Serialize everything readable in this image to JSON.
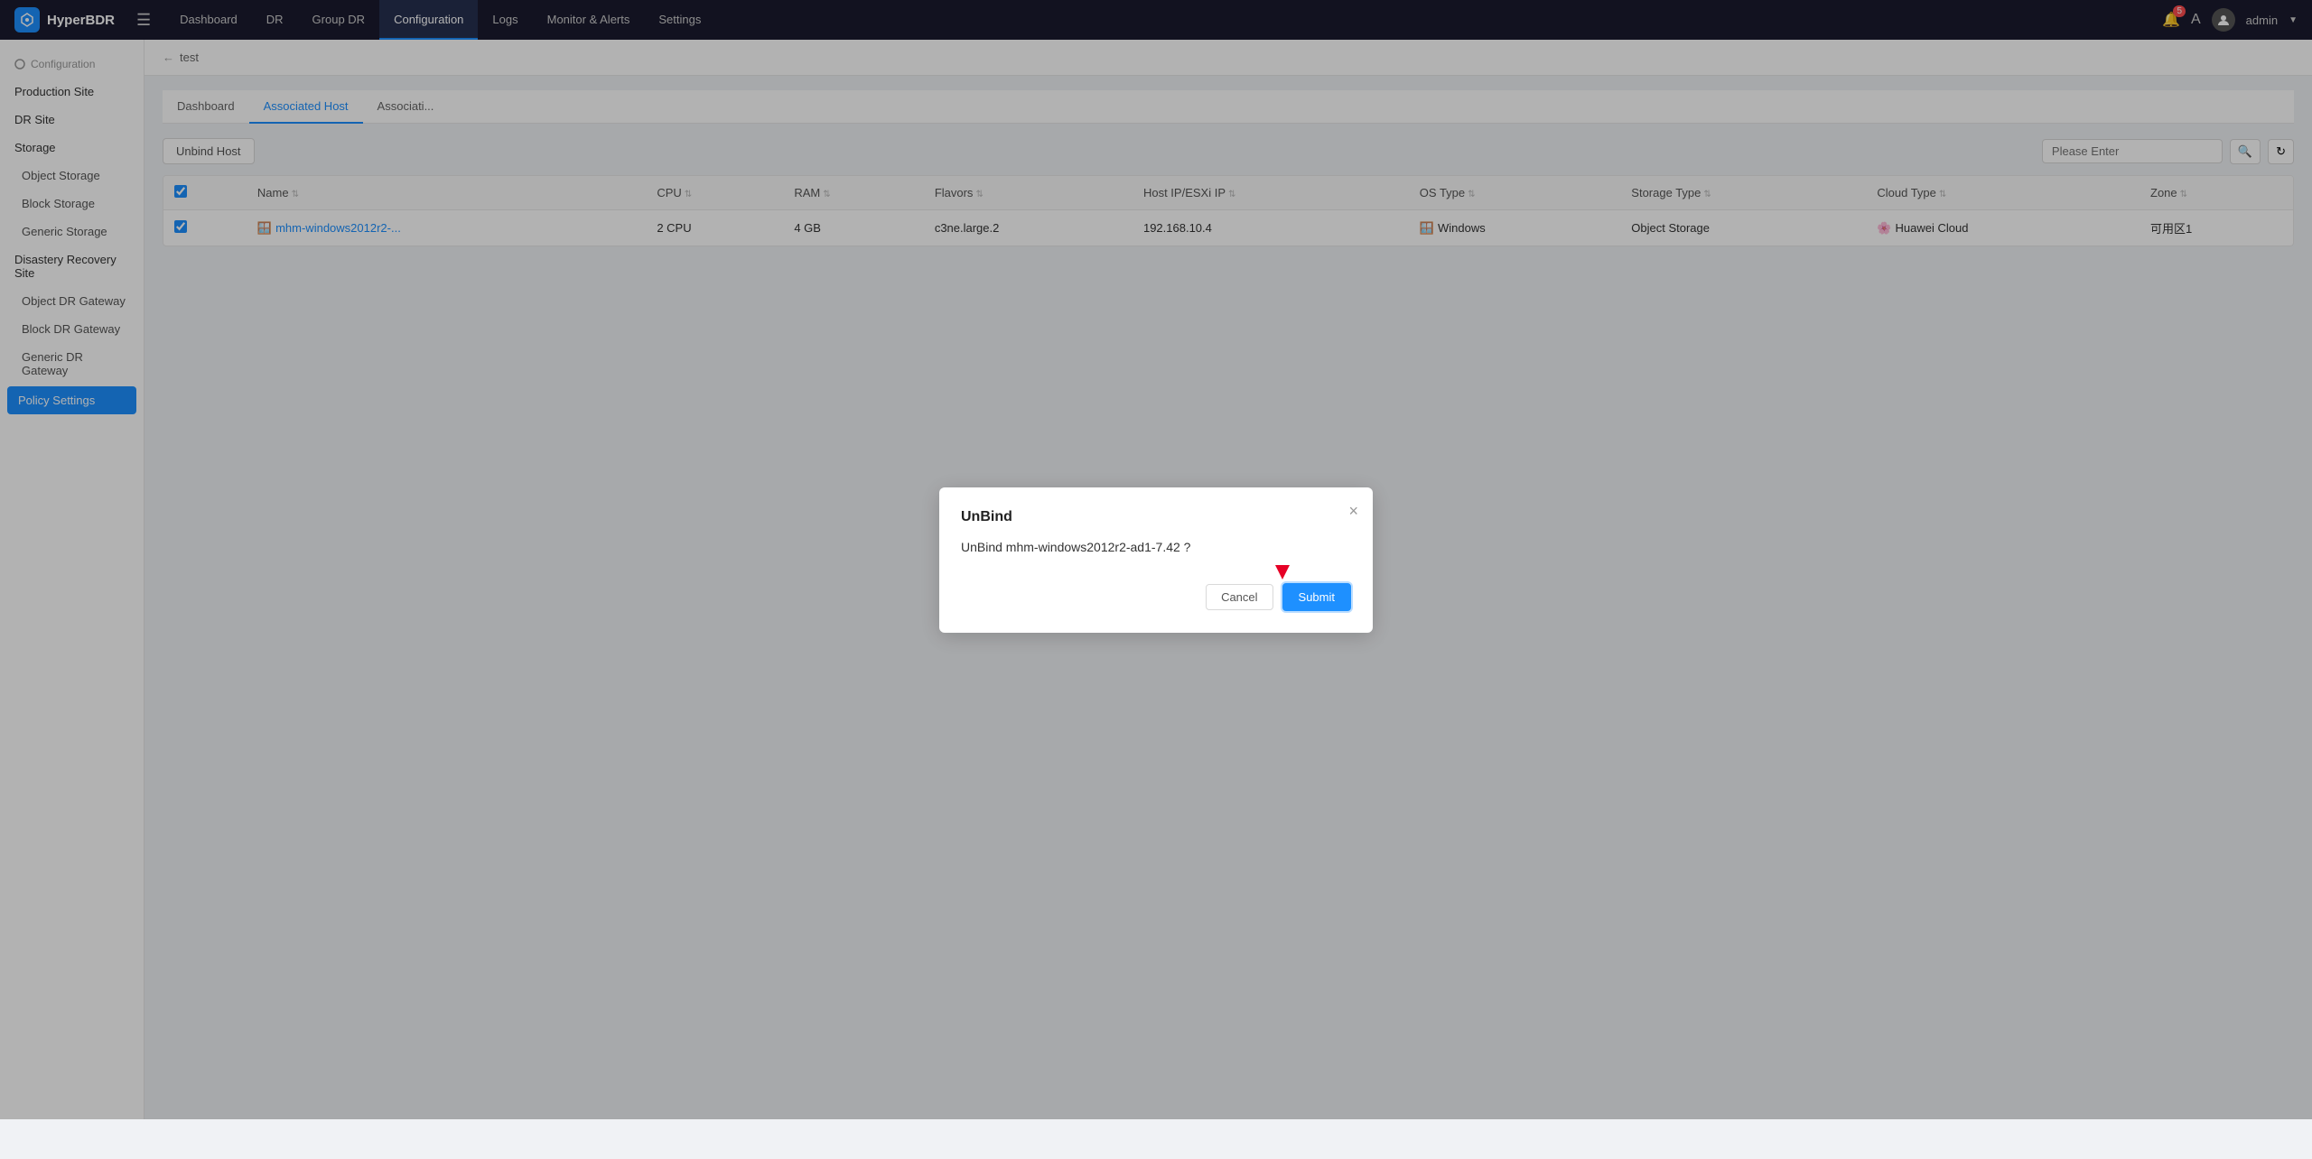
{
  "app": {
    "name": "HyperBDR",
    "logo_text": "HyperBDR"
  },
  "topnav": {
    "links": [
      "Dashboard",
      "DR",
      "Group DR",
      "Configuration",
      "Logs",
      "Monitor & Alerts",
      "Settings"
    ],
    "active_link": "Configuration",
    "user": "admin",
    "notification_count": "5"
  },
  "sidebar": {
    "section_title": "Configuration",
    "items": [
      {
        "label": "Production Site",
        "level": "parent",
        "active": false
      },
      {
        "label": "DR Site",
        "level": "parent",
        "active": false
      },
      {
        "label": "Storage",
        "level": "parent",
        "active": false
      },
      {
        "label": "Object Storage",
        "level": "child",
        "active": false
      },
      {
        "label": "Block Storage",
        "level": "child",
        "active": false
      },
      {
        "label": "Generic Storage",
        "level": "child",
        "active": false
      },
      {
        "label": "Disastery Recovery Site",
        "level": "parent",
        "active": false
      },
      {
        "label": "Object DR Gateway",
        "level": "child",
        "active": false
      },
      {
        "label": "Block DR Gateway",
        "level": "child",
        "active": false
      },
      {
        "label": "Generic DR Gateway",
        "level": "child",
        "active": false
      },
      {
        "label": "Policy Settings",
        "level": "child",
        "active": true
      }
    ]
  },
  "breadcrumb": {
    "back_arrow": "←",
    "current": "test"
  },
  "tabs": [
    {
      "label": "Dashboard",
      "active": false
    },
    {
      "label": "Associated Host",
      "active": true
    },
    {
      "label": "Associati...",
      "active": false
    }
  ],
  "toolbar": {
    "unbind_button": "Unbind Host",
    "search_placeholder": "Please Enter"
  },
  "table": {
    "columns": [
      {
        "label": "Name",
        "sortable": true
      },
      {
        "label": "CPU",
        "sortable": true
      },
      {
        "label": "RAM",
        "sortable": true
      },
      {
        "label": "Flavors",
        "sortable": true
      },
      {
        "label": "Host IP/ESXi IP",
        "sortable": true
      },
      {
        "label": "OS Type",
        "sortable": true
      },
      {
        "label": "Storage Type",
        "sortable": true
      },
      {
        "label": "Cloud Type",
        "sortable": true
      },
      {
        "label": "Zone",
        "sortable": true
      }
    ],
    "rows": [
      {
        "checked": true,
        "name": "mhm-windows2012r2-...",
        "cpu": "2 CPU",
        "ram": "4 GB",
        "flavors": "c3ne.large.2",
        "host_ip": "192.168.10.4",
        "os_type": "Windows",
        "storage_type": "Object Storage",
        "cloud_type": "Huawei Cloud",
        "zone": "可用区1"
      }
    ]
  },
  "modal": {
    "title": "UnBind",
    "message": "UnBind mhm-windows2012r2-ad1-7.42 ?",
    "cancel_label": "Cancel",
    "submit_label": "Submit"
  }
}
